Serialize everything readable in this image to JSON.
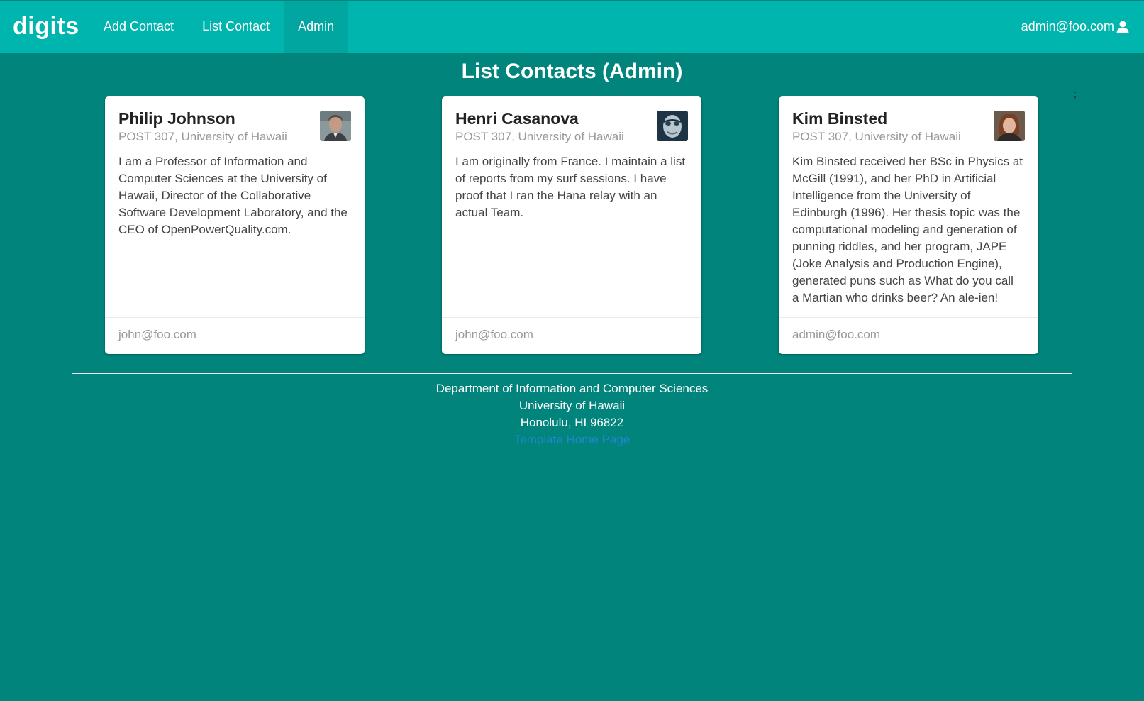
{
  "navbar": {
    "brand": "digits",
    "items": [
      {
        "label": "Add Contact"
      },
      {
        "label": "List Contact"
      },
      {
        "label": "Admin"
      }
    ],
    "user": "admin@foo.com"
  },
  "page": {
    "title": "List Contacts (Admin)",
    "stray_text": ";"
  },
  "contacts": [
    {
      "name": "Philip Johnson",
      "address": "POST 307, University of Hawaii",
      "description": "I am a Professor of Information and Computer Sciences at the University of Hawaii, Director of the Collaborative Software Development Laboratory, and the CEO of OpenPowerQuality.com.",
      "owner": "john@foo.com"
    },
    {
      "name": "Henri Casanova",
      "address": "POST 307, University of Hawaii",
      "description": "I am originally from France. I maintain a list of reports from my surf sessions. I have proof that I ran the Hana relay with an actual Team.",
      "owner": "john@foo.com"
    },
    {
      "name": "Kim Binsted",
      "address": "POST 307, University of Hawaii",
      "description": "Kim Binsted received her BSc in Physics at McGill (1991), and her PhD in Artificial Intelligence from the University of Edinburgh (1996). Her thesis topic was the computational modeling and generation of punning riddles, and her program, JAPE (Joke Analysis and Production Engine), generated puns such as What do you call a Martian who drinks beer? An ale-ien!",
      "owner": "admin@foo.com"
    }
  ],
  "footer": {
    "line1": "Department of Information and Computer Sciences",
    "line2": "University of Hawaii",
    "line3": "Honolulu, HI 96822",
    "link": "Template Home Page"
  },
  "colors": {
    "navbar": "#00b5ad",
    "background": "#00847c",
    "link": "#2185d0"
  },
  "icons": {
    "user": "user-icon"
  }
}
